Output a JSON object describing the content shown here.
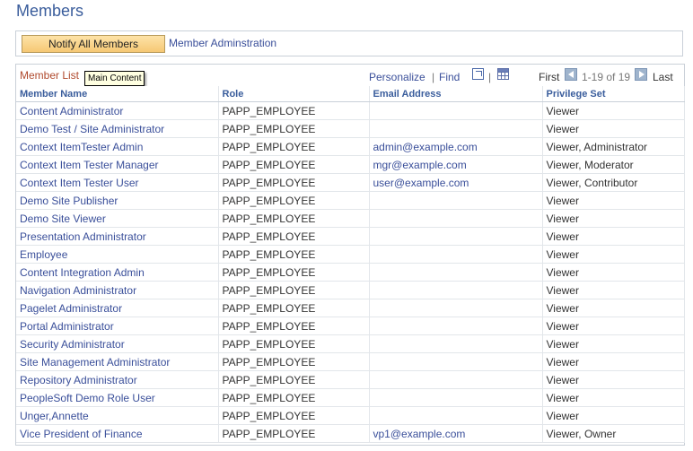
{
  "page": {
    "title": "Members"
  },
  "actions": {
    "notify_label": "Notify All Members",
    "admin_link": "Member Adminstration"
  },
  "grid": {
    "title": "Member List",
    "tooltip": "Main Content",
    "personalize": "Personalize",
    "find": "Find",
    "pipe": "|",
    "first": "First",
    "count": "1-19 of 19",
    "last": "Last",
    "columns": [
      "Member Name",
      "Role",
      "Email Address",
      "Privilege Set"
    ],
    "rows": [
      {
        "name": "Content Administrator",
        "role": "PAPP_EMPLOYEE",
        "email": "",
        "privilege": "Viewer"
      },
      {
        "name": "Demo Test / Site Administrator",
        "role": "PAPP_EMPLOYEE",
        "email": "",
        "privilege": "Viewer"
      },
      {
        "name": "Context ItemTester Admin",
        "role": "PAPP_EMPLOYEE",
        "email": "admin@example.com",
        "privilege": "Viewer, Administrator"
      },
      {
        "name": "Context Item Tester Manager",
        "role": "PAPP_EMPLOYEE",
        "email": "mgr@example.com",
        "privilege": "Viewer, Moderator"
      },
      {
        "name": "Context Item Tester User",
        "role": "PAPP_EMPLOYEE",
        "email": "user@example.com",
        "privilege": "Viewer, Contributor"
      },
      {
        "name": "Demo Site Publisher",
        "role": "PAPP_EMPLOYEE",
        "email": "",
        "privilege": "Viewer"
      },
      {
        "name": "Demo Site Viewer",
        "role": "PAPP_EMPLOYEE",
        "email": "",
        "privilege": "Viewer"
      },
      {
        "name": "Presentation Administrator",
        "role": "PAPP_EMPLOYEE",
        "email": "",
        "privilege": "Viewer"
      },
      {
        "name": "Employee",
        "role": "PAPP_EMPLOYEE",
        "email": "",
        "privilege": "Viewer"
      },
      {
        "name": "Content Integration Admin",
        "role": "PAPP_EMPLOYEE",
        "email": "",
        "privilege": "Viewer"
      },
      {
        "name": "Navigation Administrator",
        "role": "PAPP_EMPLOYEE",
        "email": "",
        "privilege": "Viewer"
      },
      {
        "name": "Pagelet Administrator",
        "role": "PAPP_EMPLOYEE",
        "email": "",
        "privilege": "Viewer"
      },
      {
        "name": "Portal Administrator",
        "role": "PAPP_EMPLOYEE",
        "email": "",
        "privilege": "Viewer"
      },
      {
        "name": "Security Administrator",
        "role": "PAPP_EMPLOYEE",
        "email": "",
        "privilege": "Viewer"
      },
      {
        "name": "Site Management Administrator",
        "role": "PAPP_EMPLOYEE",
        "email": "",
        "privilege": "Viewer"
      },
      {
        "name": "Repository Administrator",
        "role": "PAPP_EMPLOYEE",
        "email": "",
        "privilege": "Viewer"
      },
      {
        "name": "PeopleSoft Demo Role User",
        "role": "PAPP_EMPLOYEE",
        "email": "",
        "privilege": "Viewer"
      },
      {
        "name": "Unger,Annette",
        "role": "PAPP_EMPLOYEE",
        "email": "",
        "privilege": "Viewer"
      },
      {
        "name": "Vice President of Finance",
        "role": "PAPP_EMPLOYEE",
        "email": "vp1@example.com",
        "privilege": "Viewer, Owner"
      }
    ]
  },
  "icons": {
    "zoom": "zoom-grid-icon",
    "download": "download-spreadsheet-icon",
    "prev": "arrow-left-icon",
    "next": "arrow-right-icon"
  },
  "colors": {
    "title": "#3a5d9c",
    "link": "#3a4f9a",
    "grid_title": "#b04a2e",
    "button": "#f6c874"
  }
}
